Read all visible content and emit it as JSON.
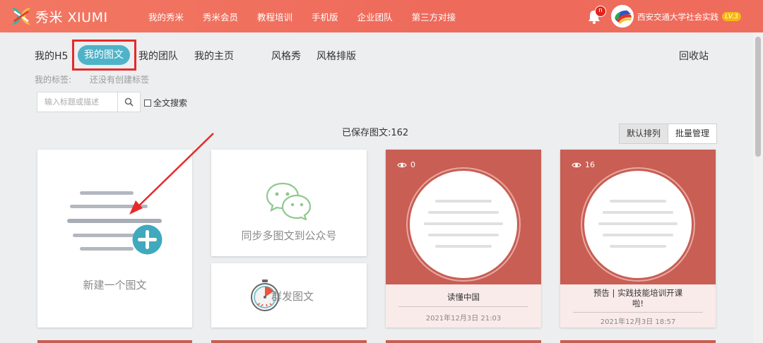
{
  "brand": {
    "name": "秀米 XIUMI"
  },
  "nav": [
    "我的秀米",
    "秀米会员",
    "教程培训",
    "手机版",
    "企业团队",
    "第三方对接"
  ],
  "notifications": {
    "badge": "n"
  },
  "user": {
    "name": "西安交通大学社会实践",
    "level": "LV.3"
  },
  "tabs": {
    "h5": "我的H5",
    "articles": "我的图文",
    "team": "我的团队",
    "homepage": "我的主页",
    "style_show": "风格秀",
    "style_layout": "风格排版",
    "recycle": "回收站"
  },
  "tags": {
    "label": "我的标签:",
    "empty": "还没有创建标签"
  },
  "search": {
    "placeholder": "输入标题或描述",
    "fulltext_label": "全文搜索"
  },
  "saved_count_text": "已保存图文:162",
  "buttons": {
    "default_sort": "默认排列",
    "batch_manage": "批量管理"
  },
  "cards": {
    "new_article": "新建一个图文",
    "sync": "同步多图文到公众号",
    "mass_send": "群发图文"
  },
  "articles": [
    {
      "views": "0",
      "title": "读懂中国",
      "date": "2021年12月3日 21:03"
    },
    {
      "views": "16",
      "title": "预告 | 实践技能培训开课啦!",
      "date": "2021年12月3日 18:57"
    }
  ],
  "colors": {
    "topbar": "#ef6d5d",
    "accent": "#4eb3c8",
    "highlight": "#e52a2a",
    "article_bg": "#c85e54"
  }
}
